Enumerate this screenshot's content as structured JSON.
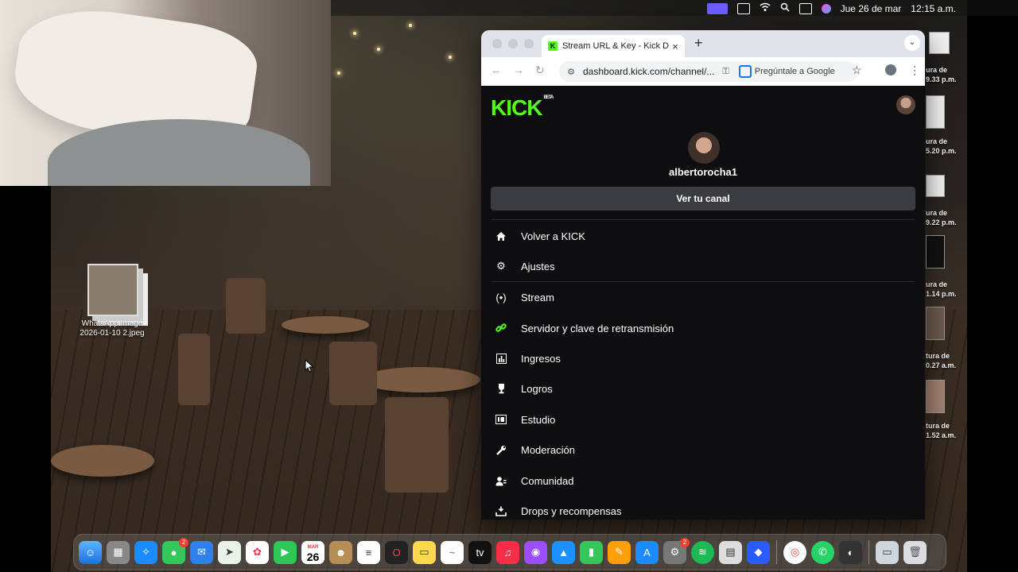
{
  "menubar": {
    "date": "Jue 26 de mar",
    "time": "12:15 a.m."
  },
  "desktop": {
    "file_label_line1": "WhatsApp Image",
    "file_label_line2": "2026-01-10 2.jpeg",
    "right_files": [
      {
        "line1": "ura de",
        "line2": "9.33 p.m."
      },
      {
        "line1": "ura de",
        "line2": "5.20 p.m."
      },
      {
        "line1": "ura de",
        "line2": "9.22 p.m."
      },
      {
        "line1": "ura de",
        "line2": "1.14 p.m."
      },
      {
        "line1": "tura de",
        "line2": "0.27 a.m."
      },
      {
        "line1": "tura de",
        "line2": "1.52 a.m."
      }
    ]
  },
  "browser": {
    "tab_title": "Stream URL & Key - Kick Das",
    "url": "dashboard.kick.com/channel/...",
    "ask_google": "Pregúntale a Google"
  },
  "page": {
    "logo": "KICK",
    "logo_badge": "BETA",
    "username": "albertorocha1",
    "view_channel": "Ver tu canal",
    "nav": [
      {
        "icon": "home-icon",
        "label": "Volver a KICK"
      },
      {
        "icon": "gear-icon",
        "label": "Ajustes"
      },
      {
        "icon": "broadcast-icon",
        "label": "Stream"
      },
      {
        "icon": "link-icon",
        "label": "Servidor y clave de retransmisión"
      },
      {
        "icon": "chart-icon",
        "label": "Ingresos"
      },
      {
        "icon": "trophy-icon",
        "label": "Logros"
      },
      {
        "icon": "studio-icon",
        "label": "Estudio"
      },
      {
        "icon": "wrench-icon",
        "label": "Moderación"
      },
      {
        "icon": "community-icon",
        "label": "Comunidad"
      },
      {
        "icon": "drops-icon",
        "label": "Drops y recompensas"
      }
    ]
  },
  "dock": {
    "calendar_month": "MAR",
    "calendar_day": "26",
    "messages_badge": "2",
    "settings_badge": "2"
  },
  "colors": {
    "kick_green": "#53fc18",
    "page_bg": "#0e0e10",
    "button_gray": "#3b3c40"
  }
}
